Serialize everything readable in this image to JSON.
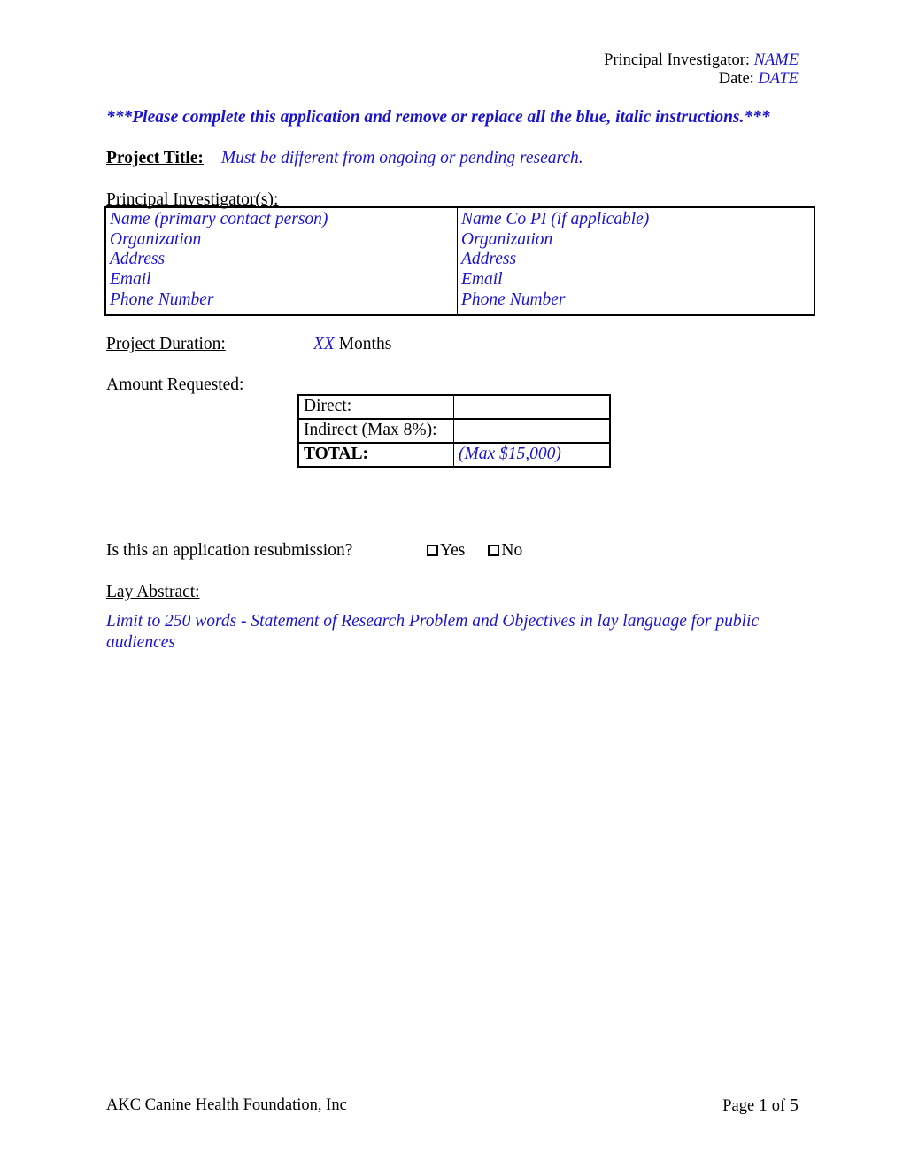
{
  "header": {
    "pi_line_label": "Principal Investigator: ",
    "pi_line_value": "NAME",
    "date_line_label": "Date: ",
    "date_line_value": "DATE"
  },
  "instruction_banner": {
    "text": "***Please complete this application and remove or replace all the blue, italic instructions.***"
  },
  "project_title": {
    "label": "Project Title:",
    "placeholder": "Must be different from ongoing or pending research."
  },
  "principal_investigators": {
    "heading": "Principal Investigator(s):",
    "columns": [
      {
        "lines": [
          "Name (primary contact person)",
          "Organization",
          "Address",
          "Email",
          "Phone Number"
        ]
      },
      {
        "lines": [
          "Name Co PI (if applicable)",
          "Organization",
          "Address",
          "Email",
          "Phone Number"
        ]
      }
    ]
  },
  "project_duration": {
    "label": "Project Duration:",
    "quantity": "XX",
    "unit": "Months"
  },
  "amount_requested": {
    "heading": "Amount Requested:",
    "rows": [
      {
        "label": "Direct:",
        "value": ""
      },
      {
        "label": "Indirect (Max 8%):",
        "value": ""
      },
      {
        "label": "TOTAL:",
        "value": "(Max $15,000)"
      }
    ]
  },
  "resubmission": {
    "question": "Is this an application resubmission?",
    "options": [
      {
        "checkbox_icon": "checkbox-unchecked-icon",
        "label": "Yes"
      },
      {
        "checkbox_icon": "checkbox-unchecked-icon",
        "label": "No"
      }
    ]
  },
  "lay_abstract": {
    "heading": "Lay Abstract:",
    "placeholder": "Limit to 250 words - Statement of Research Problem and Objectives in lay language for public audiences"
  },
  "footer": {
    "organization": "AKC Canine Health Foundation, Inc",
    "page_prefix": "Page ",
    "page_current": "1",
    "page_joiner": " of ",
    "page_total": "5"
  },
  "colors": {
    "instruction_blue": "#1a14cc",
    "text_black": "#000000",
    "page_background": "#ffffff"
  }
}
